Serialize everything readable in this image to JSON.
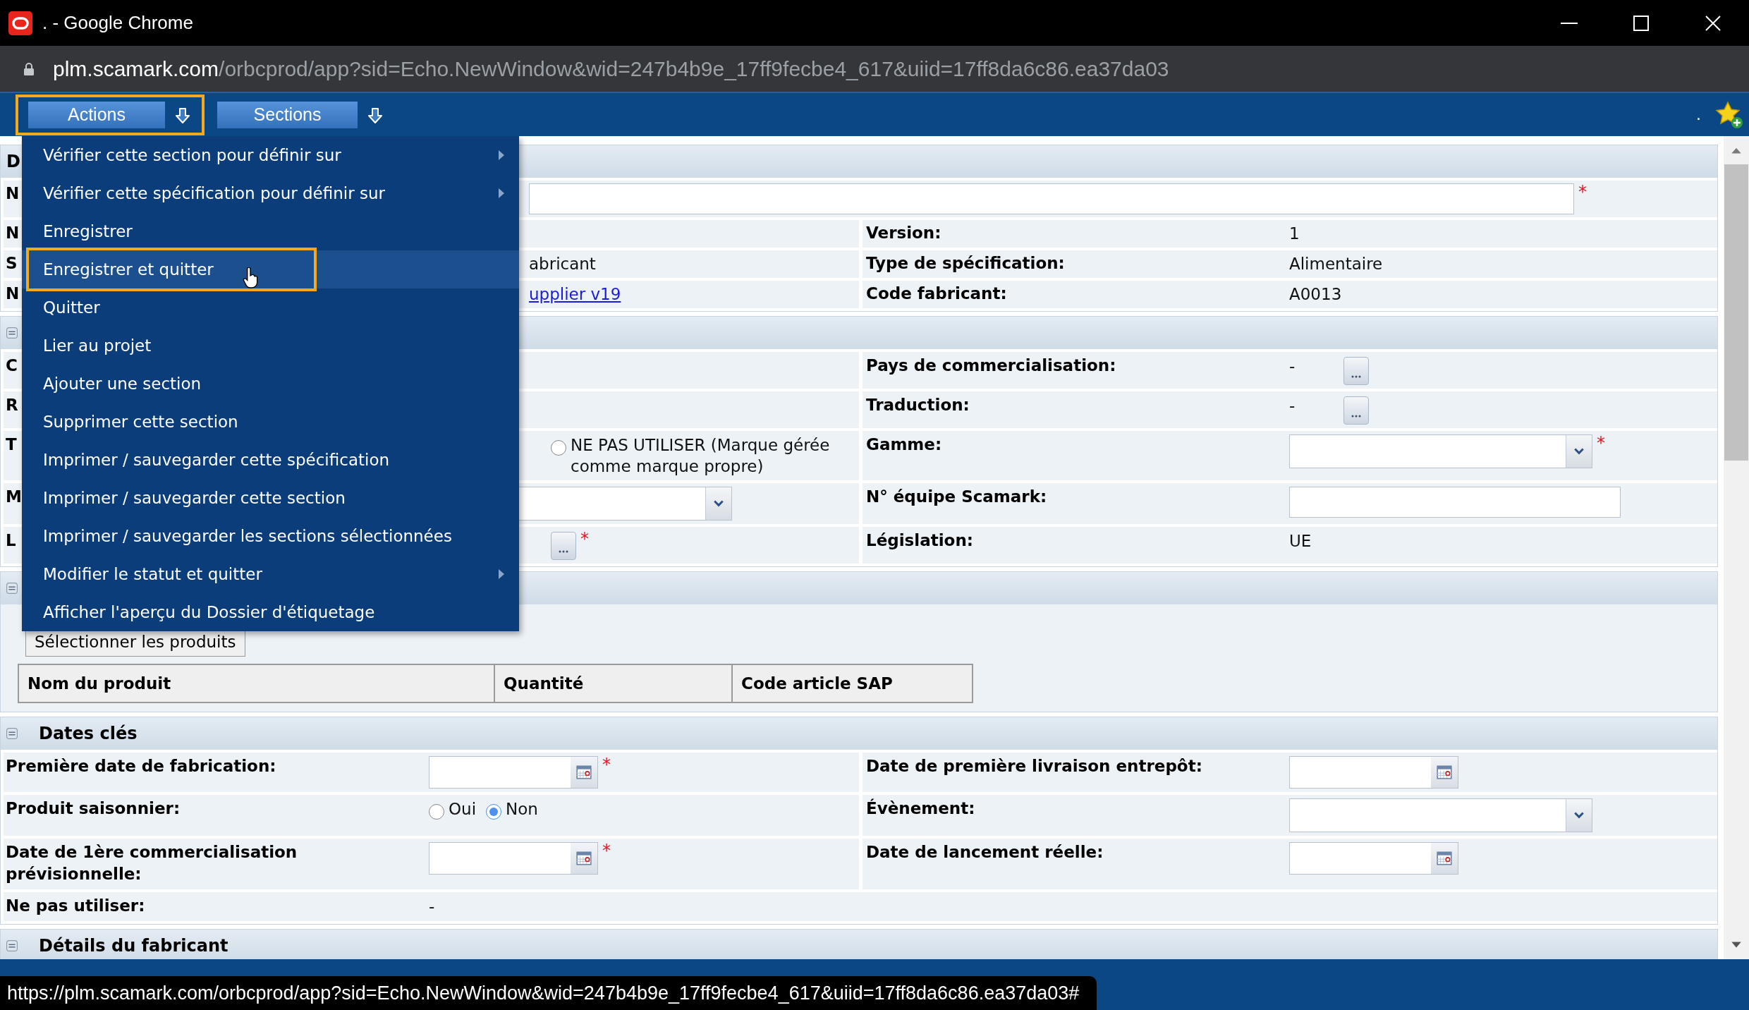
{
  "window": {
    "title": ". - Google Chrome"
  },
  "address_bar": {
    "host": "plm.scamark.com",
    "path": "/orbcprod/app?sid=Echo.NewWindow&wid=247b4b9e_17ff9fecbe4_617&uiid=17ff8da6c86.ea37da03"
  },
  "toolbar": {
    "buttons": [
      {
        "label": "Actions",
        "selected": true
      },
      {
        "label": "Sections",
        "selected": false
      }
    ],
    "trailing_text": "."
  },
  "actions_menu": {
    "items": [
      {
        "label": "Vérifier cette section pour définir sur",
        "submenu": true,
        "highlighted": false
      },
      {
        "label": "Vérifier cette spécification pour définir sur",
        "submenu": true,
        "highlighted": false
      },
      {
        "label": "Enregistrer",
        "submenu": false,
        "highlighted": false
      },
      {
        "label": "Enregistrer et quitter",
        "submenu": false,
        "highlighted": true
      },
      {
        "label": "Quitter",
        "submenu": false,
        "highlighted": false
      },
      {
        "label": "Lier au projet",
        "submenu": false,
        "highlighted": false
      },
      {
        "label": "Ajouter une section",
        "submenu": false,
        "highlighted": false
      },
      {
        "label": "Supprimer cette section",
        "submenu": false,
        "highlighted": false
      },
      {
        "label": "Imprimer / sauvegarder cette spécification",
        "submenu": false,
        "highlighted": false
      },
      {
        "label": "Imprimer / sauvegarder cette section",
        "submenu": false,
        "highlighted": false
      },
      {
        "label": "Imprimer / sauvegarder les sections sélectionnées",
        "submenu": false,
        "highlighted": false
      },
      {
        "label": "Modifier le statut et quitter",
        "submenu": true,
        "highlighted": false
      },
      {
        "label": "Afficher l'aperçu du Dossier d'étiquetage",
        "submenu": false,
        "highlighted": false
      }
    ]
  },
  "sections": [
    {
      "kind": "fields",
      "title": "D",
      "collapsible": false,
      "rows": [
        {
          "cells": [
            {
              "label": "N",
              "field": {
                "kind": "input",
                "required_mark": "*"
              }
            }
          ]
        },
        {
          "cells": [
            {
              "label": "N"
            },
            {
              "label": "Version:",
              "field": {
                "kind": "text",
                "value": "1"
              }
            }
          ]
        },
        {
          "cells": [
            {
              "label": "S",
              "field": {
                "kind": "text",
                "value": "abricant"
              }
            },
            {
              "label": "Type de spécification:",
              "field": {
                "kind": "text",
                "value": "Alimentaire"
              }
            }
          ]
        },
        {
          "cells": [
            {
              "label": "N",
              "field": {
                "kind": "link",
                "value": "upplier v19"
              }
            },
            {
              "label": "Code fabricant:",
              "field": {
                "kind": "text",
                "value": "A0013"
              }
            }
          ]
        }
      ]
    },
    {
      "kind": "fields",
      "collapsible": true,
      "rows": [
        {
          "cells": [
            {
              "label": "C"
            },
            {
              "label": "Pays de commercialisation:",
              "field": {
                "kind": "lookup",
                "value": "-"
              }
            }
          ]
        },
        {
          "cells": [
            {
              "label": "R"
            },
            {
              "label": "Traduction:",
              "field": {
                "kind": "lookup",
                "value": "-"
              }
            }
          ]
        },
        {
          "cells": [
            {
              "label": "T",
              "field": {
                "kind": "radios",
                "options": [
                  {
                    "label": "NE PAS UTILISER (Marque gérée comme marque propre)",
                    "selected": false
                  }
                ]
              }
            },
            {
              "label": "Gamme:",
              "field": {
                "kind": "select",
                "required_mark": "*"
              }
            }
          ]
        },
        {
          "cells": [
            {
              "label": "M",
              "field": {
                "kind": "select"
              }
            },
            {
              "label": "N° équipe Scamark:",
              "field": {
                "kind": "input"
              }
            }
          ]
        },
        {
          "cells": [
            {
              "label": "L",
              "field": {
                "kind": "lookup",
                "required_mark": "*"
              }
            },
            {
              "label": "Législation:",
              "field": {
                "kind": "text",
                "value": "UE"
              }
            }
          ]
        }
      ]
    },
    {
      "kind": "products",
      "collapsible": true,
      "button": "Sélectionner les produits",
      "columns": [
        "Nom du produit",
        "Quantité",
        "Code article SAP"
      ]
    },
    {
      "kind": "fields",
      "title": "Dates clés",
      "collapsible": true,
      "rows": [
        {
          "cells": [
            {
              "label": "Première date de fabrication:",
              "field": {
                "kind": "date",
                "required_mark": "*"
              }
            },
            {
              "label": "Date de première livraison entrepôt:",
              "field": {
                "kind": "date"
              }
            }
          ]
        },
        {
          "cells": [
            {
              "label": "Produit saisonnier:",
              "field": {
                "kind": "radios",
                "options": [
                  {
                    "label": "Oui",
                    "selected": false
                  },
                  {
                    "label": "Non",
                    "selected": true
                  }
                ]
              }
            },
            {
              "label": "Évènement:",
              "field": {
                "kind": "select"
              }
            }
          ]
        },
        {
          "cells": [
            {
              "label": "Date de 1ère commercialisation prévisionnelle:",
              "field": {
                "kind": "date",
                "required_mark": "*"
              }
            },
            {
              "label": "Date de lancement réelle:",
              "field": {
                "kind": "date"
              }
            }
          ]
        },
        {
          "cells": [
            {
              "label": "Ne pas utiliser:",
              "field": {
                "kind": "text",
                "value": "-"
              }
            }
          ]
        }
      ]
    },
    {
      "kind": "fields",
      "title": "Détails du fabricant",
      "collapsible": true
    }
  ],
  "status_tooltip": "https://plm.scamark.com/orbcprod/app?sid=Echo.NewWindow&wid=247b4b9e_17ff9fecbe4_617&uiid=17ff8da6c86.ea37da03#"
}
